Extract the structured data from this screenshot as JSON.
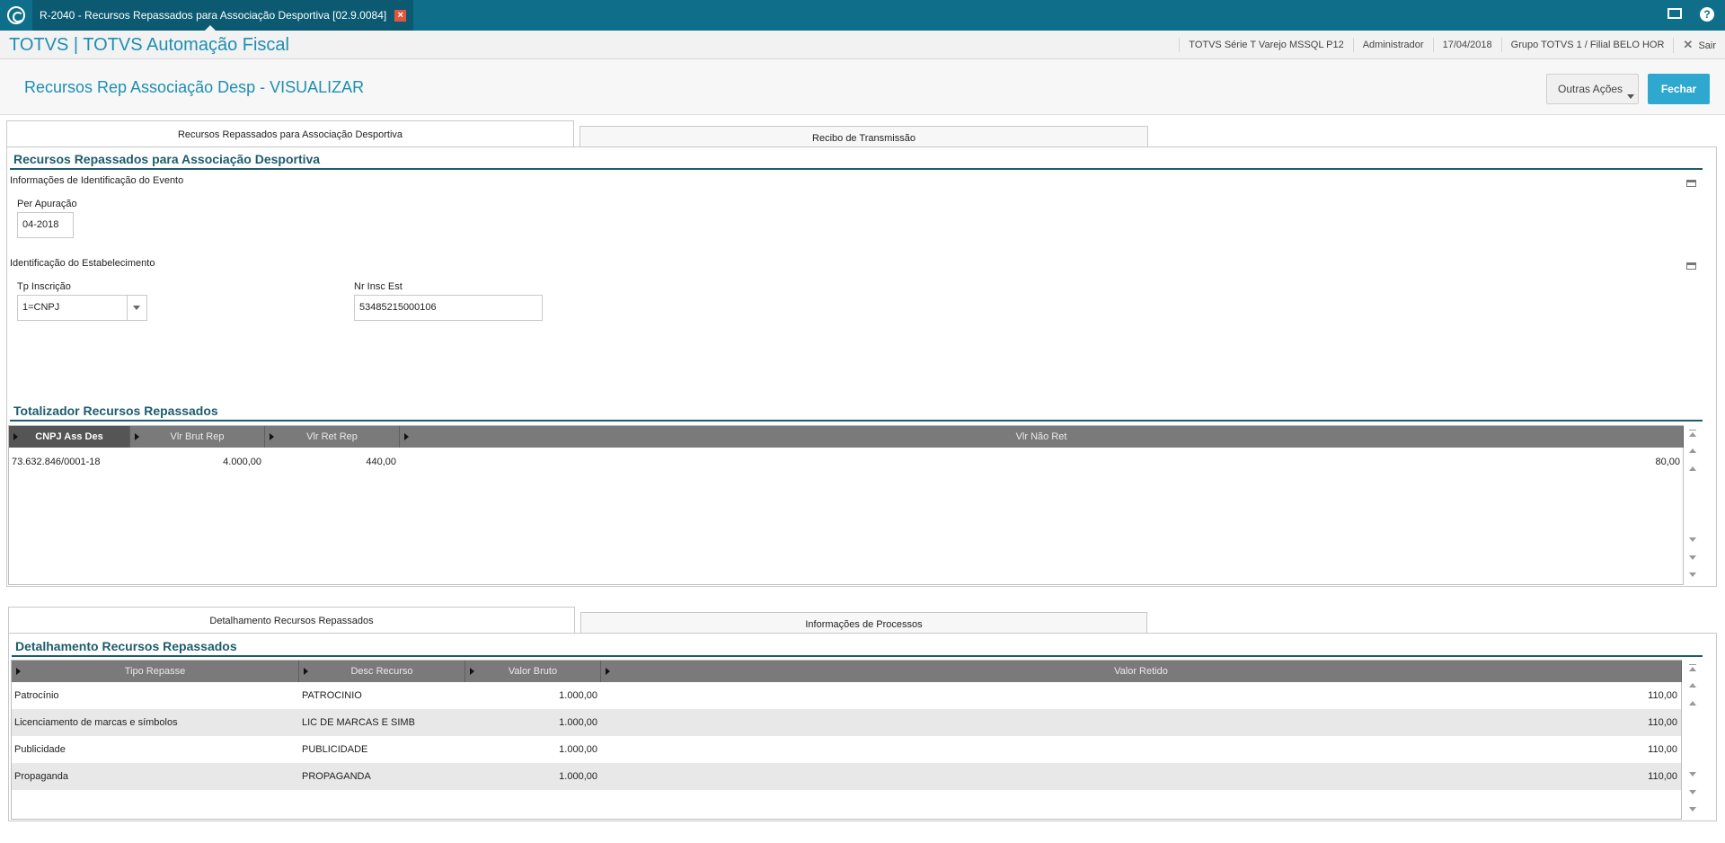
{
  "window_tab": {
    "title": "R-2040 - Recursos Repassados para Associação Desportiva [02.9.0084]"
  },
  "header": {
    "brand": "TOTVS | TOTVS Automação Fiscal",
    "environment": "TOTVS Série T Varejo MSSQL P12",
    "user": "Administrador",
    "date": "17/04/2018",
    "branch": "Grupo TOTVS 1 / Filial BELO HOR",
    "exit_label": "Sair"
  },
  "page": {
    "title": "Recursos Rep Associação Desp - VISUALIZAR",
    "outras_acoes": "Outras Ações",
    "fechar": "Fechar"
  },
  "top_tabs": [
    {
      "label": "Recursos Repassados para Associação Desportiva"
    },
    {
      "label": "Recibo de Transmissão"
    }
  ],
  "form": {
    "section_title": "Recursos Repassados para Associação Desportiva",
    "event_group": "Informações de Identificação do Evento",
    "per_apuracao_label": "Per Apuração",
    "per_apuracao_value": "04-2018",
    "estab_group": "Identificação do Estabelecimento",
    "tp_inscricao_label": "Tp Inscrição",
    "tp_inscricao_value": "1=CNPJ",
    "nr_insc_label": "Nr Insc Est",
    "nr_insc_value": "53485215000106"
  },
  "totalizador": {
    "title": "Totalizador Recursos Repassados",
    "columns": [
      "CNPJ Ass Des",
      "Vlr Brut Rep",
      "Vlr Ret Rep",
      "Vlr Não Ret"
    ],
    "rows": [
      [
        "73.632.846/0001-18",
        "4.000,00",
        "440,00",
        "80,00"
      ]
    ]
  },
  "bottom_tabs": [
    {
      "label": "Detalhamento Recursos Repassados"
    },
    {
      "label": "Informações de Processos"
    }
  ],
  "detalhamento": {
    "title": "Detalhamento Recursos Repassados",
    "columns": [
      "Tipo Repasse",
      "Desc Recurso",
      "Valor Bruto",
      "Valor Retido"
    ],
    "rows": [
      [
        "Patrocínio",
        "PATROCINIO",
        "1.000,00",
        "110,00"
      ],
      [
        "Licenciamento de marcas e símbolos",
        "LIC DE MARCAS E SIMB",
        "1.000,00",
        "110,00"
      ],
      [
        "Publicidade",
        "PUBLICIDADE",
        "1.000,00",
        "110,00"
      ],
      [
        "Propaganda",
        "PROPAGANDA",
        "1.000,00",
        "110,00"
      ]
    ]
  },
  "colors": {
    "top_bar": "#0f6e8a",
    "accent": "#1e8fb2",
    "button_primary": "#2fa8cf",
    "section": "#1d5c6e"
  }
}
